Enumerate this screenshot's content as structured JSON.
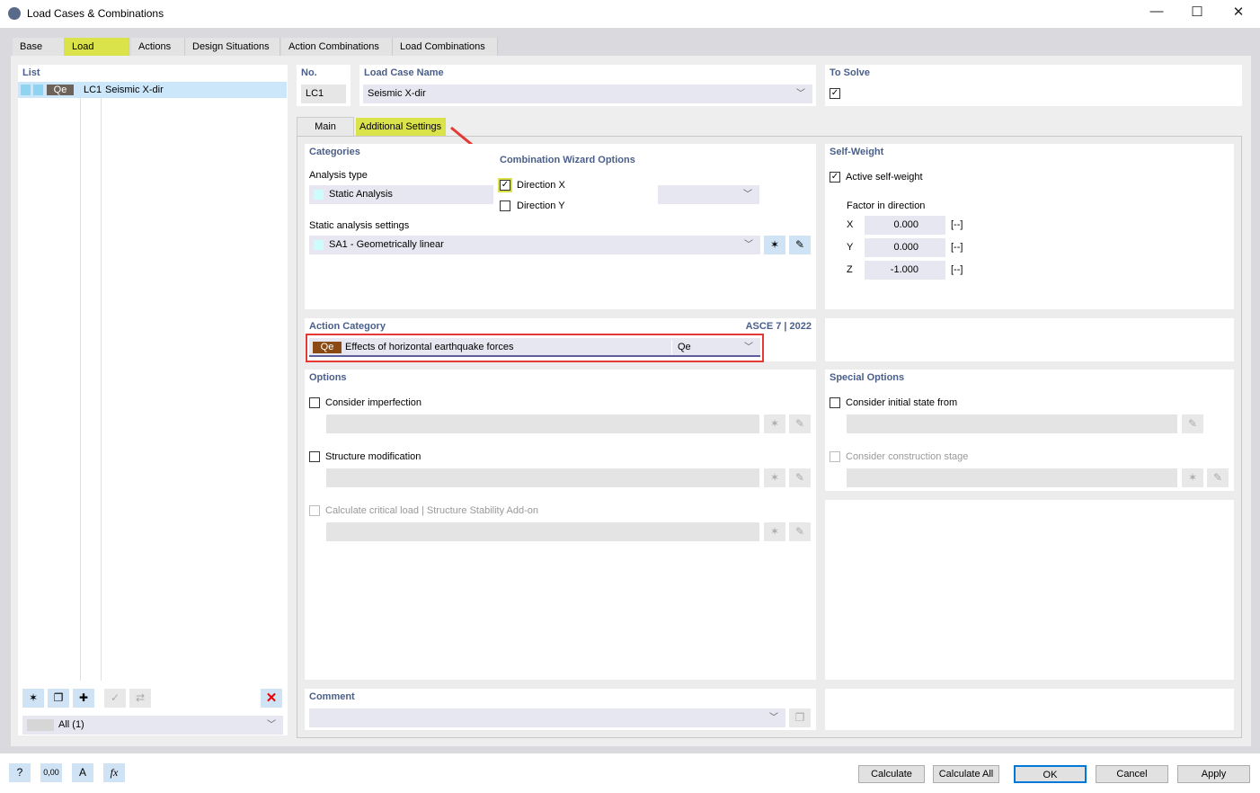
{
  "window": {
    "title": "Load Cases & Combinations"
  },
  "tabs": [
    "Base",
    "Load Cases",
    "Actions",
    "Design Situations",
    "Action Combinations",
    "Load Combinations"
  ],
  "list": {
    "header": "List",
    "items": [
      {
        "code": "Qe",
        "no": "LC1",
        "name": "Seismic X-dir"
      }
    ],
    "filter": "All (1)"
  },
  "no": {
    "label": "No.",
    "value": "LC1"
  },
  "name": {
    "label": "Load Case Name",
    "value": "Seismic X-dir"
  },
  "to_solve": {
    "label": "To Solve",
    "checked": true
  },
  "subtabs": [
    "Main",
    "Additional Settings"
  ],
  "categories": {
    "header": "Categories",
    "analysis_label": "Analysis type",
    "analysis_value": "Static Analysis",
    "settings_label": "Static analysis settings",
    "settings_value": "SA1 - Geometrically linear"
  },
  "wizard": {
    "header": "Combination Wizard Options",
    "dir_x": "Direction X",
    "dir_y": "Direction Y",
    "dir_x_checked": true,
    "dir_y_checked": false
  },
  "self_weight": {
    "header": "Self-Weight",
    "active": "Active self-weight",
    "factor_label": "Factor in direction",
    "rows": [
      {
        "axis": "X",
        "value": "0.000",
        "unit": "[--]"
      },
      {
        "axis": "Y",
        "value": "0.000",
        "unit": "[--]"
      },
      {
        "axis": "Z",
        "value": "-1.000",
        "unit": "[--]"
      }
    ]
  },
  "action_category": {
    "header": "Action Category",
    "standard": "ASCE 7 | 2022",
    "code": "Qe",
    "description": "Effects of horizontal earthquake forces",
    "short": "Qe",
    "code_color": "#8b4a14"
  },
  "options": {
    "header": "Options",
    "imperfection": "Consider imperfection",
    "modification": "Structure modification",
    "critical": "Calculate critical load | Structure Stability Add-on"
  },
  "special": {
    "header": "Special Options",
    "initial": "Consider initial state from",
    "construction": "Consider construction stage"
  },
  "comment": {
    "header": "Comment"
  },
  "buttons": {
    "calculate": "Calculate",
    "calculate_all": "Calculate All",
    "ok": "OK",
    "cancel": "Cancel",
    "apply": "Apply"
  },
  "footer_icons": {
    "units": "0,00"
  }
}
